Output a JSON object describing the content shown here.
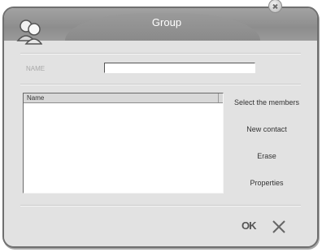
{
  "dialog": {
    "title": "Group"
  },
  "form": {
    "name_label": "NAME",
    "name_value": ""
  },
  "members_list": {
    "column_header": "Name",
    "rows": []
  },
  "actions": {
    "select_members": "Select the members",
    "new_contact": "New contact",
    "erase": "Erase",
    "properties": "Properties"
  },
  "footer": {
    "ok_label": "OK"
  },
  "icons": {
    "avatar": "group-users-icon",
    "close": "close-icon",
    "cancel": "cancel-x-icon"
  },
  "colors": {
    "titlebar": "#8d8d8d",
    "background": "#e2e2e2",
    "text": "#333333"
  }
}
